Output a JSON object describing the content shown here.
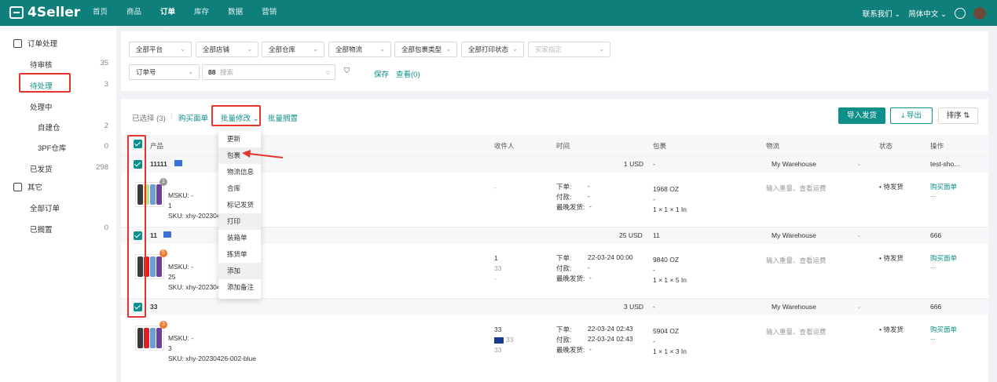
{
  "header": {
    "logo": "4Seller",
    "nav": [
      "首页",
      "商品",
      "订单",
      "库存",
      "数据",
      "营销"
    ],
    "active_nav": "订单",
    "contact": "联系我们 ⌄",
    "language": "简体中文 ⌄"
  },
  "sidebar": {
    "group1": "订单处理",
    "items1": [
      {
        "label": "待审核",
        "count": "35"
      },
      {
        "label": "待处理",
        "count": "3"
      },
      {
        "label": "处理中",
        "count": ""
      },
      {
        "label": "自建仓",
        "count": "2"
      },
      {
        "label": "3PF仓库",
        "count": "0"
      },
      {
        "label": "已发货",
        "count": "298"
      }
    ],
    "group2": "其它",
    "items2": [
      {
        "label": "全部订单",
        "count": ""
      },
      {
        "label": "已搁置",
        "count": "0"
      }
    ]
  },
  "filters": {
    "selects": [
      "全部平台",
      "全部店铺",
      "全部仓库",
      "全部物流",
      "全部包裹类型",
      "全部打印状态",
      "买家指定"
    ],
    "order_no": "订单号",
    "search_placeholder": "搜索",
    "save": "保存",
    "view": "查看(0)"
  },
  "toolbar": {
    "selected": "已选择 (3)",
    "sep": "|",
    "buy_label": "购买面单",
    "batch_edit": "批量修改 ⌄",
    "batch_hold": "批量搁置",
    "import_ship": "导入发货",
    "export": "导出",
    "sort": "排序 ⇅"
  },
  "table_headers": [
    "产品",
    "收件人",
    "时间",
    "包裹",
    "物流",
    "状态",
    "操作"
  ],
  "menu": [
    "更新",
    "包裹",
    "物流信息",
    "合库",
    "标记发货",
    "打印",
    "装箱单",
    "拣货单",
    "添加",
    "添加备注"
  ],
  "orders": [
    {
      "id": "11111",
      "amount": "1 USD",
      "pkg_no": "-",
      "warehouse": "My Warehouse",
      "op": "test-sho...",
      "badge": "1",
      "msku": "MSKU: -",
      "qty": "1",
      "sku": "SKU: xhy-20230426-002-blue",
      "recipient": [
        "-",
        "",
        ""
      ],
      "time": [
        [
          "下单:",
          "-"
        ],
        [
          "付款:",
          "-"
        ],
        [
          "最晚发货:",
          "-"
        ]
      ],
      "weight": "1968 OZ",
      "dash": "-",
      "dims": "1 × 1 × 1 In",
      "logistics": "输入重量、查看运费",
      "status": "• 待发货",
      "buy": "购买面单",
      "more": "..."
    },
    {
      "id": "11",
      "amount": "25 USD",
      "pkg_no": "11",
      "warehouse": "My Warehouse",
      "op": "666",
      "badge": "5",
      "msku": "MSKU: -",
      "qty": "25",
      "sku": "SKU: xhy-20230426-002-blue",
      "recipient": [
        "1",
        "33",
        "-"
      ],
      "time": [
        [
          "下单:",
          "22-03-24 00:00"
        ],
        [
          "付款:",
          "-"
        ],
        [
          "最晚发货:",
          "-"
        ]
      ],
      "weight": "9840 OZ",
      "dash": "-",
      "dims": "1 × 1 × 5 In",
      "logistics": "输入重量、查看运费",
      "status": "• 待发货",
      "buy": "购买面单",
      "more": "..."
    },
    {
      "id": "33",
      "amount": "3 USD",
      "pkg_no": "-",
      "warehouse": "My Warehouse",
      "op": "666",
      "badge": "3",
      "msku": "MSKU: -",
      "qty": "3",
      "sku": "SKU: xhy-20230426-002-blue",
      "recipient": [
        "33",
        "33",
        "33"
      ],
      "time": [
        [
          "下单:",
          "22-03-24 02:43"
        ],
        [
          "付款:",
          "22-03-24 02:43"
        ],
        [
          "最晚发货:",
          "-"
        ]
      ],
      "weight": "5904 OZ",
      "dash": "-",
      "dims": "1 × 1 × 3 In",
      "logistics": "输入重量、查看运费",
      "status": "• 待发货",
      "buy": "购买面单",
      "more": "..."
    }
  ],
  "colors": {
    "brand": "#0e7f7a",
    "accent": "#0e8f89",
    "highlight": "#e5342b"
  }
}
